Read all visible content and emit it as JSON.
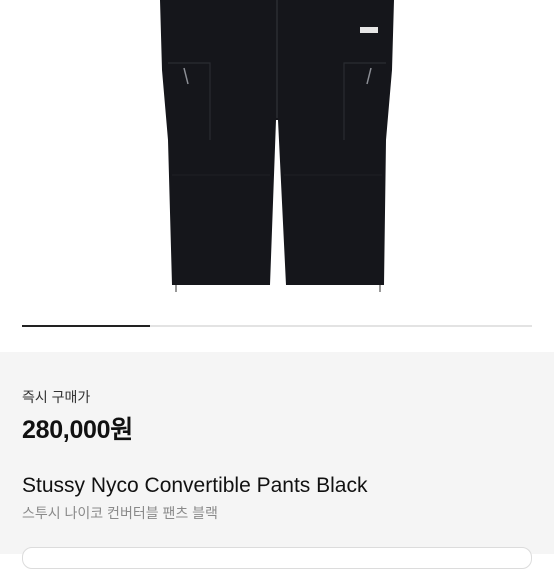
{
  "product": {
    "image_icon": "black-cargo-pants-photo",
    "buy_now_label": "즉시 구매가",
    "price": "280,000원",
    "name_en": "Stussy Nyco Convertible Pants Black",
    "name_ko": "스투시 나이코 컨버터블 팬츠 블랙"
  },
  "carousel": {
    "active_fraction": 0.25
  },
  "colors": {
    "garment": "#15161b",
    "background": "#f5f5f5",
    "indicator_active": "#222222"
  }
}
